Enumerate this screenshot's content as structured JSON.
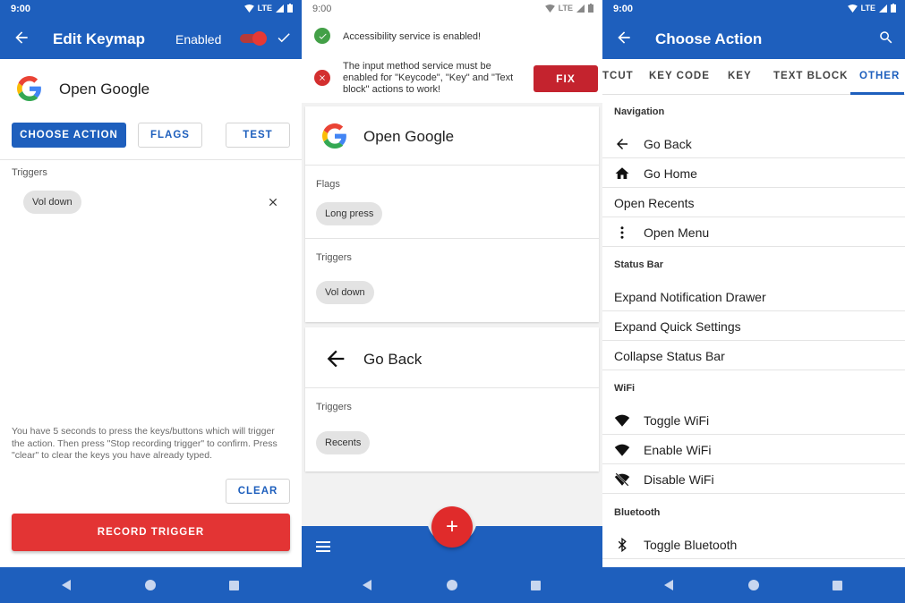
{
  "panel1": {
    "status_time": "9:00",
    "status_network": "LTE",
    "title": "Edit Keymap",
    "enabled_label": "Enabled",
    "action_name": "Open Google",
    "choose_action": "CHOOSE ACTION",
    "flags": "FLAGS",
    "test": "TEST",
    "triggers_label": "Triggers",
    "trigger_chip": "Vol down",
    "help_text": "You have 5 seconds to press the keys/buttons which will trigger the action. Then press \"Stop recording trigger\" to confirm. Press \"clear\" to clear the keys you have already typed.",
    "clear": "CLEAR",
    "record": "RECORD TRIGGER"
  },
  "panel2": {
    "status_time": "9:00",
    "status_network": "LTE",
    "notice_ok": "Accessibility service is enabled!",
    "notice_err": "The input method service must be enabled for \"Keycode\", \"Key\" and \"Text block\" actions to work!",
    "fix": "FIX",
    "card1": {
      "action": "Open Google",
      "flags_label": "Flags",
      "flag_chip": "Long press",
      "triggers_label": "Triggers",
      "trigger_chip": "Vol down"
    },
    "card2": {
      "action": "Go Back",
      "triggers_label": "Triggers",
      "trigger_chip": "Recents"
    },
    "fab": "+"
  },
  "panel3": {
    "status_time": "9:00",
    "status_network": "LTE",
    "title": "Choose Action",
    "tabs": [
      "TCUT",
      "KEY CODE",
      "KEY",
      "TEXT BLOCK",
      "OTHER"
    ],
    "sections": {
      "navigation": "Navigation",
      "status_bar": "Status Bar",
      "wifi": "WiFi",
      "bluetooth": "Bluetooth"
    },
    "items": {
      "go_back": "Go Back",
      "go_home": "Go Home",
      "open_recents": "Open Recents",
      "open_menu": "Open Menu",
      "expand_notification": "Expand Notification Drawer",
      "expand_quick": "Expand Quick Settings",
      "collapse_status": "Collapse Status Bar",
      "toggle_wifi": "Toggle WiFi",
      "enable_wifi": "Enable WiFi",
      "disable_wifi": "Disable WiFi",
      "toggle_bluetooth": "Toggle Bluetooth"
    }
  },
  "colors": {
    "primary": "#1e5fbd",
    "accent_red": "#e33434",
    "fix_red": "#c4232e",
    "ok_green": "#43a047",
    "error_red": "#d32f2f"
  }
}
